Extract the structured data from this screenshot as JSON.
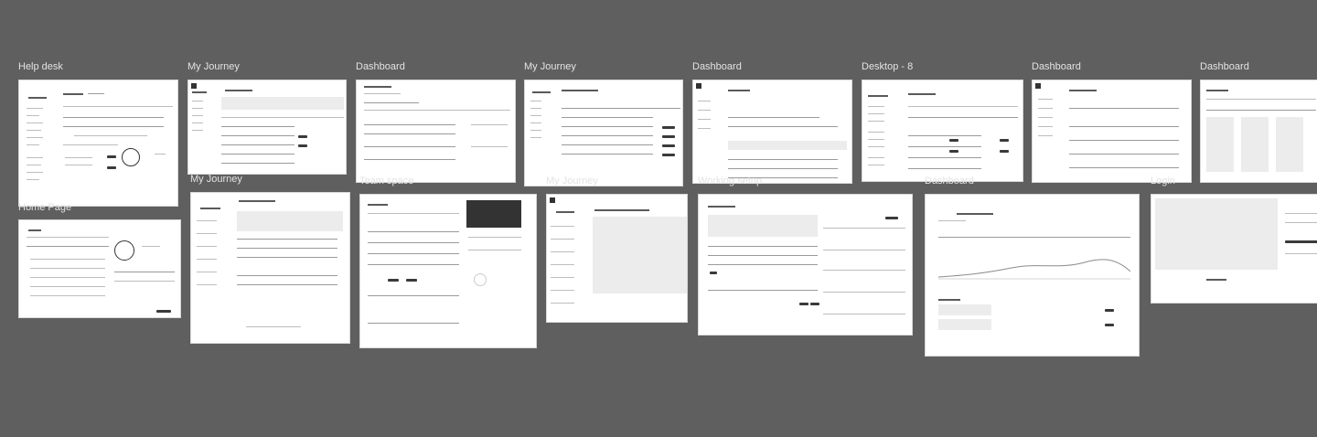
{
  "canvas": {
    "background": "#5f5f5f",
    "label_color": "#e3e3e3"
  },
  "frames": [
    {
      "label": "Help desk"
    },
    {
      "label": "My Journey"
    },
    {
      "label": "Dashboard"
    },
    {
      "label": "My Journey"
    },
    {
      "label": "Dashboard"
    },
    {
      "label": "Desktop - 8"
    },
    {
      "label": "Dashboard"
    },
    {
      "label": "Dashboard"
    },
    {
      "label": "Home Page"
    },
    {
      "label": "My Journey"
    },
    {
      "label": "Team space"
    },
    {
      "label": "My Journey"
    },
    {
      "label": "Working setup"
    },
    {
      "label": "Dashboard"
    },
    {
      "label": "Login"
    }
  ]
}
